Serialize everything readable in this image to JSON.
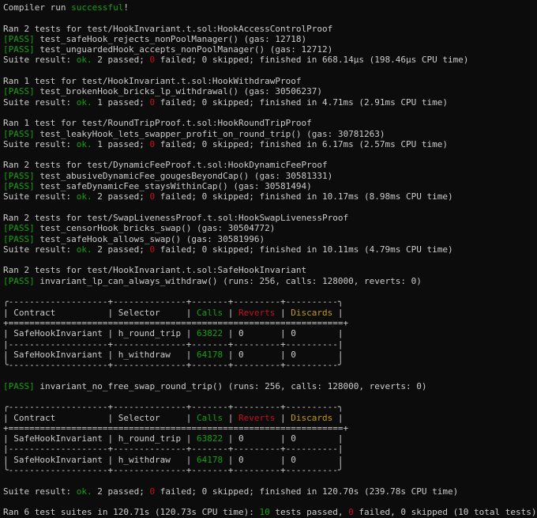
{
  "colors": {
    "background": "#0c0c0c",
    "foreground": "#cccccc",
    "green": "#13a10e",
    "red": "#c50f1f",
    "yellow": "#c19c00"
  },
  "lines": [
    [
      {
        "t": "Compiler run "
      },
      {
        "t": "successful",
        "c": "g"
      },
      {
        "t": "!"
      }
    ],
    [],
    [
      {
        "t": "Ran 2 tests for test/HookInvariant.t.sol:HookAccessControlProof"
      }
    ],
    [
      {
        "t": "[PASS]",
        "c": "g"
      },
      {
        "t": " test_safeHook_rejects_nonPoolManager() (gas: 12718)"
      }
    ],
    [
      {
        "t": "[PASS]",
        "c": "g"
      },
      {
        "t": " test_unguardedHook_accepts_nonPoolManager() (gas: 12712)"
      }
    ],
    [
      {
        "t": "Suite result: "
      },
      {
        "t": "ok.",
        "c": "g"
      },
      {
        "t": " 2 passed; "
      },
      {
        "t": "0",
        "c": "r"
      },
      {
        "t": " failed; 0 skipped; finished in 668.14µs (198.46µs CPU time)"
      }
    ],
    [],
    [
      {
        "t": "Ran 1 test for test/HookInvariant.t.sol:HookWithdrawProof"
      }
    ],
    [
      {
        "t": "[PASS]",
        "c": "g"
      },
      {
        "t": " test_brokenHook_bricks_lp_withdrawal() (gas: 30506237)"
      }
    ],
    [
      {
        "t": "Suite result: "
      },
      {
        "t": "ok.",
        "c": "g"
      },
      {
        "t": " 1 passed; "
      },
      {
        "t": "0",
        "c": "r"
      },
      {
        "t": " failed; 0 skipped; finished in 4.71ms (2.91ms CPU time)"
      }
    ],
    [],
    [
      {
        "t": "Ran 1 test for test/RoundTripProof.t.sol:HookRoundTripProof"
      }
    ],
    [
      {
        "t": "[PASS]",
        "c": "g"
      },
      {
        "t": " test_leakyHook_lets_swapper_profit_on_round_trip() (gas: 30781263)"
      }
    ],
    [
      {
        "t": "Suite result: "
      },
      {
        "t": "ok.",
        "c": "g"
      },
      {
        "t": " 1 passed; "
      },
      {
        "t": "0",
        "c": "r"
      },
      {
        "t": " failed; 0 skipped; finished in 6.17ms (2.57ms CPU time)"
      }
    ],
    [],
    [
      {
        "t": "Ran 2 tests for test/DynamicFeeProof.t.sol:HookDynamicFeeProof"
      }
    ],
    [
      {
        "t": "[PASS]",
        "c": "g"
      },
      {
        "t": " test_abusiveDynamicFee_gougesBeyondCap() (gas: 30581331)"
      }
    ],
    [
      {
        "t": "[PASS]",
        "c": "g"
      },
      {
        "t": " test_safeDynamicFee_staysWithinCap() (gas: 30581494)"
      }
    ],
    [
      {
        "t": "Suite result: "
      },
      {
        "t": "ok.",
        "c": "g"
      },
      {
        "t": " 2 passed; "
      },
      {
        "t": "0",
        "c": "r"
      },
      {
        "t": " failed; 0 skipped; finished in 10.17ms (8.98ms CPU time)"
      }
    ],
    [],
    [
      {
        "t": "Ran 2 tests for test/SwapLivenessProof.t.sol:HookSwapLivenessProof"
      }
    ],
    [
      {
        "t": "[PASS]",
        "c": "g"
      },
      {
        "t": " test_censorHook_bricks_swap() (gas: 30504772)"
      }
    ],
    [
      {
        "t": "[PASS]",
        "c": "g"
      },
      {
        "t": " test_safeHook_allows_swap() (gas: 30581996)"
      }
    ],
    [
      {
        "t": "Suite result: "
      },
      {
        "t": "ok.",
        "c": "g"
      },
      {
        "t": " 2 passed; "
      },
      {
        "t": "0",
        "c": "r"
      },
      {
        "t": " failed; 0 skipped; finished in 10.11ms (4.79ms CPU time)"
      }
    ],
    [],
    [
      {
        "t": "Ran 2 tests for test/HookInvariant.t.sol:SafeHookInvariant"
      }
    ],
    [
      {
        "t": "[PASS]",
        "c": "g"
      },
      {
        "t": " invariant_lp_can_always_withdraw() (runs: 256, calls: 128000, reverts: 0)"
      }
    ],
    [],
    [
      {
        "t": "╭-------------------+--------------+-------+---------+----------╮"
      }
    ],
    [
      {
        "t": "| Contract          | Selector     | "
      },
      {
        "t": "Calls",
        "c": "g"
      },
      {
        "t": " | "
      },
      {
        "t": "Reverts",
        "c": "r"
      },
      {
        "t": " | "
      },
      {
        "t": "Discards",
        "c": "y"
      },
      {
        "t": " |"
      }
    ],
    [
      {
        "t": "+================================================================+"
      }
    ],
    [
      {
        "t": "| SafeHookInvariant | h_round_trip | "
      },
      {
        "t": "63822",
        "c": "g"
      },
      {
        "t": " | 0       | 0        |"
      }
    ],
    [
      {
        "t": "|-------------------+--------------+-------+---------+----------|"
      }
    ],
    [
      {
        "t": "| SafeHookInvariant | h_withdraw   | "
      },
      {
        "t": "64178",
        "c": "g"
      },
      {
        "t": " | 0       | 0        |"
      }
    ],
    [
      {
        "t": "╰-------------------+--------------+-------+---------+----------╯"
      }
    ],
    [],
    [
      {
        "t": "[PASS]",
        "c": "g"
      },
      {
        "t": " invariant_no_free_swap_round_trip() (runs: 256, calls: 128000, reverts: 0)"
      }
    ],
    [],
    [
      {
        "t": "╭-------------------+--------------+-------+---------+----------╮"
      }
    ],
    [
      {
        "t": "| Contract          | Selector     | "
      },
      {
        "t": "Calls",
        "c": "g"
      },
      {
        "t": " | "
      },
      {
        "t": "Reverts",
        "c": "r"
      },
      {
        "t": " | "
      },
      {
        "t": "Discards",
        "c": "y"
      },
      {
        "t": " |"
      }
    ],
    [
      {
        "t": "+================================================================+"
      }
    ],
    [
      {
        "t": "| SafeHookInvariant | h_round_trip | "
      },
      {
        "t": "63822",
        "c": "g"
      },
      {
        "t": " | 0       | 0        |"
      }
    ],
    [
      {
        "t": "|-------------------+--------------+-------+---------+----------|"
      }
    ],
    [
      {
        "t": "| SafeHookInvariant | h_withdraw   | "
      },
      {
        "t": "64178",
        "c": "g"
      },
      {
        "t": " | 0       | 0        |"
      }
    ],
    [
      {
        "t": "╰-------------------+--------------+-------+---------+----------╯"
      }
    ],
    [],
    [
      {
        "t": "Suite result: "
      },
      {
        "t": "ok.",
        "c": "g"
      },
      {
        "t": " 2 passed; "
      },
      {
        "t": "0",
        "c": "r"
      },
      {
        "t": " failed; 0 skipped; finished in 120.70s (239.78s CPU time)"
      }
    ],
    [],
    [
      {
        "t": "Ran 6 test suites in 120.71s (120.73s CPU time): "
      },
      {
        "t": "10",
        "c": "g"
      },
      {
        "t": " tests passed, "
      },
      {
        "t": "0",
        "c": "r"
      },
      {
        "t": " failed, 0 skipped (10 total tests)"
      }
    ]
  ]
}
